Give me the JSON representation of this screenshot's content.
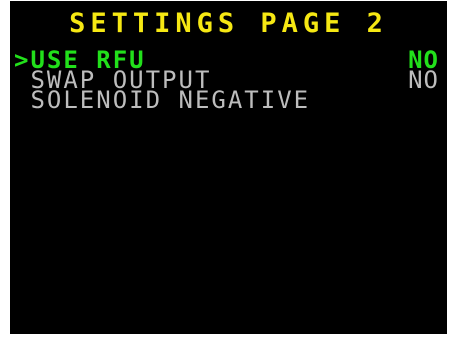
{
  "screen": {
    "title": "SETTINGS PAGE 2",
    "colors": {
      "background": "#000000",
      "title": "#f6e813",
      "selected": "#22e01b",
      "normal": "#bdbdbd"
    },
    "cursor": ">",
    "items": [
      {
        "label": "USE RFU",
        "value": "NO",
        "selected": true
      },
      {
        "label": "SWAP OUTPUT",
        "value": "NO",
        "selected": false
      },
      {
        "label": "SOLENOID NEGATIVE",
        "value": "",
        "selected": false
      }
    ]
  }
}
